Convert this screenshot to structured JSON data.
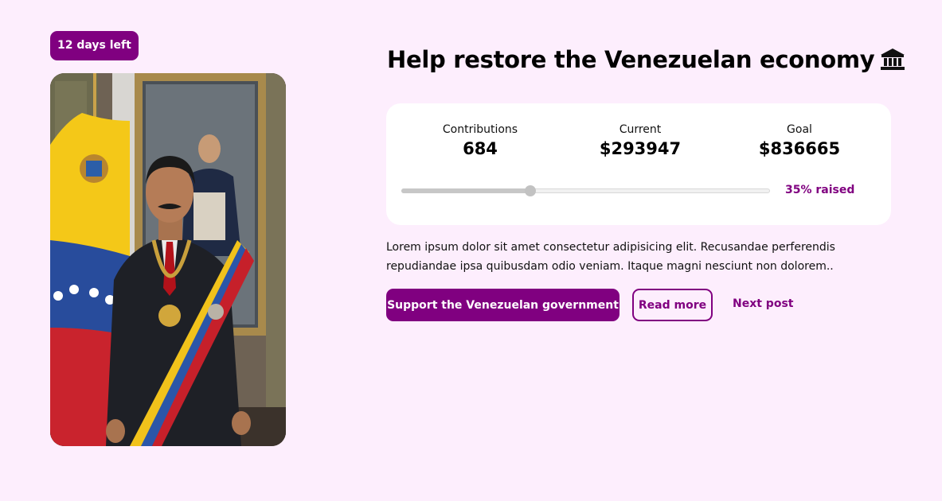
{
  "badge": {
    "text": "12 days left"
  },
  "photo": {
    "alt": "Official portrait in front of the Venezuelan flag"
  },
  "header": {
    "title": "Help restore the Venezuelan economy",
    "title_icon": "bank-icon"
  },
  "stats": {
    "contributions": {
      "label": "Contributions",
      "value": "684"
    },
    "current": {
      "label": "Current",
      "value": "$293947"
    },
    "goal": {
      "label": "Goal",
      "value": "$836665"
    }
  },
  "progress": {
    "fraction": 0.35,
    "label": "35% raised"
  },
  "description": "Lorem ipsum dolor sit amet consectetur adipisicing elit. Recusandae perferendis repudiandae ipsa quibusdam odio veniam. Itaque magni nesciunt non dolorem..",
  "actions": {
    "primary_label": "Support the Venezuelan government",
    "secondary_label": "Read more",
    "link_label": "Next post"
  },
  "colors": {
    "accent": "#800080",
    "background": "#fdeefd",
    "card": "#ffffff"
  }
}
